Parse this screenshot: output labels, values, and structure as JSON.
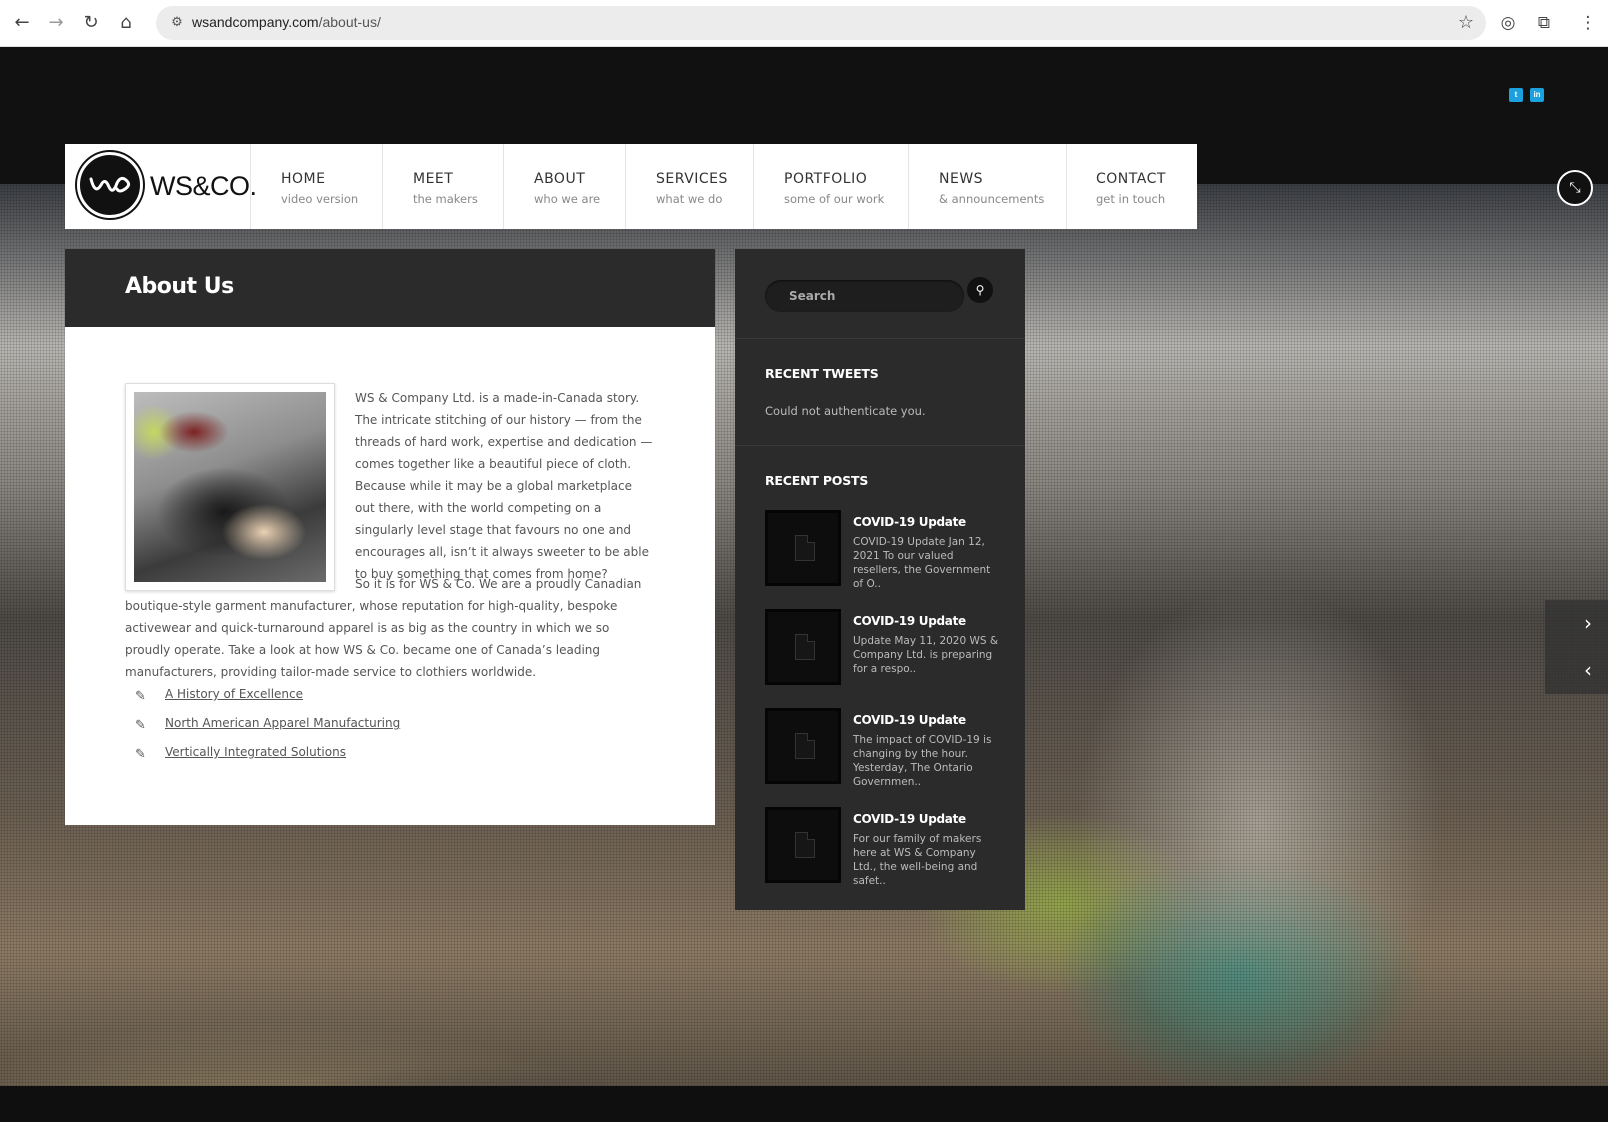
{
  "browser": {
    "url_domain": "wsandcompany.com",
    "url_path": "/about-us/",
    "back_icon": "←",
    "forward_icon": "→",
    "reload_icon": "↻",
    "home_icon": "⌂",
    "site_info_icon": "⚙",
    "star_icon": "☆",
    "translate_icon": "◎",
    "extensions_icon": "⧉",
    "menu_icon": "⋮"
  },
  "social": {
    "twitter": "t",
    "linkedin": "in"
  },
  "header": {
    "logo_text": "WS&CO.",
    "menu": [
      {
        "title": "HOME",
        "sub": "video version"
      },
      {
        "title": "MEET",
        "sub": "the makers"
      },
      {
        "title": "ABOUT",
        "sub": "who we are"
      },
      {
        "title": "SERVICES",
        "sub": "what we do"
      },
      {
        "title": "PORTFOLIO",
        "sub": "some of our work"
      },
      {
        "title": "NEWS",
        "sub": "& announcements"
      },
      {
        "title": "CONTACT",
        "sub": "get in touch"
      }
    ],
    "collapse_icon": "⤡"
  },
  "main": {
    "title": "About Us",
    "paragraph1": "WS & Company Ltd. is a made-in-Canada story. The intricate stitching of our history — from the threads of hard work, expertise and dedication — comes together like a beautiful piece of cloth. Because while it may be a global marketplace out there, with the world competing on a singularly level stage that favours no one and encourages all, isn’t it always sweeter to be able to buy something that comes from home?",
    "paragraph2": "So it is for WS & Co. We are a proudly Canadian boutique-style garment manufacturer, whose reputation for high-quality, bespoke activewear and quick-turnaround apparel is as big as the country in which we so proudly operate. Take a look at how WS & Co. became one of Canada’s leading manufacturers, providing tailor-made service to clothiers worldwide.",
    "link_icon": "✎",
    "links": [
      "A History of Excellence",
      "North American Apparel Manufacturing",
      "Vertically Integrated Solutions"
    ]
  },
  "sidebar": {
    "search_placeholder": "Search",
    "search_icon": "⚲",
    "tweets_title": "RECENT TWEETS",
    "tweets_text": "Could not authenticate you.",
    "posts_title": "RECENT POSTS",
    "posts": [
      {
        "title": "COVID-19 Update",
        "excerpt": "COVID-19 Update   Jan 12, 2021 To our valued resellers, the Government of O.."
      },
      {
        "title": "COVID-19 Update",
        "excerpt": "Update   May 11, 2020   WS & Company Ltd. is preparing for a respo.."
      },
      {
        "title": "COVID-19 Update",
        "excerpt": "The impact of COVID-19 is changing by the hour. Yesterday, The Ontario Governmen.."
      },
      {
        "title": "COVID-19 Update",
        "excerpt": "For our family of makers here at WS & Company Ltd., the well-being and safet.."
      }
    ]
  },
  "slider": {
    "next_icon": "›",
    "prev_icon": "‹"
  }
}
